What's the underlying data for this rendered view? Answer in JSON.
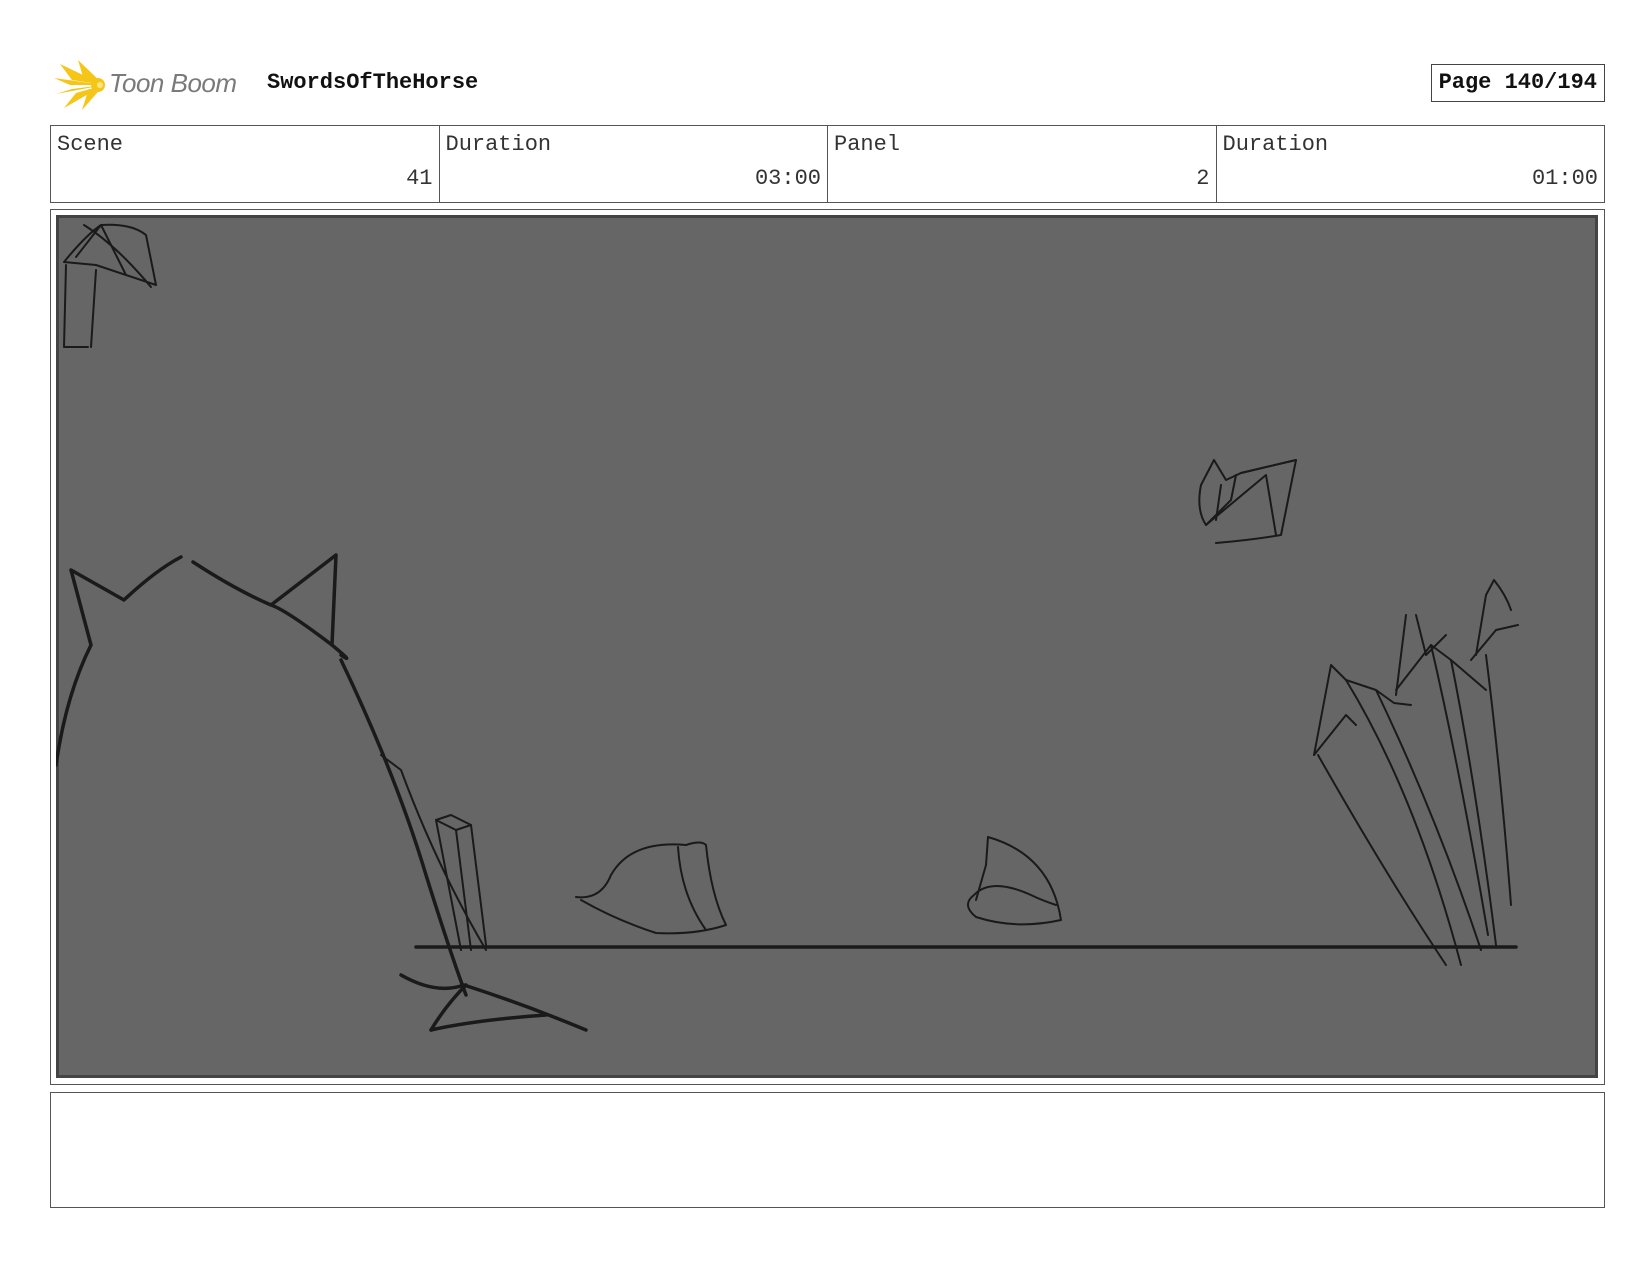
{
  "header": {
    "logo_text": "Toon Boom",
    "project_title": "SwordsOfTheHorse",
    "page_label": "Page 140/194"
  },
  "info": {
    "scene_label": "Scene",
    "scene_value": "41",
    "scene_duration_label": "Duration",
    "scene_duration_value": "03:00",
    "panel_label": "Panel",
    "panel_value": "2",
    "panel_duration_label": "Duration",
    "panel_duration_value": "01:00"
  },
  "colors": {
    "panel_background": "#666666",
    "sketch_stroke": "#1a1a1a",
    "logo_accent": "#f5c518"
  },
  "notes": {
    "text": ""
  }
}
